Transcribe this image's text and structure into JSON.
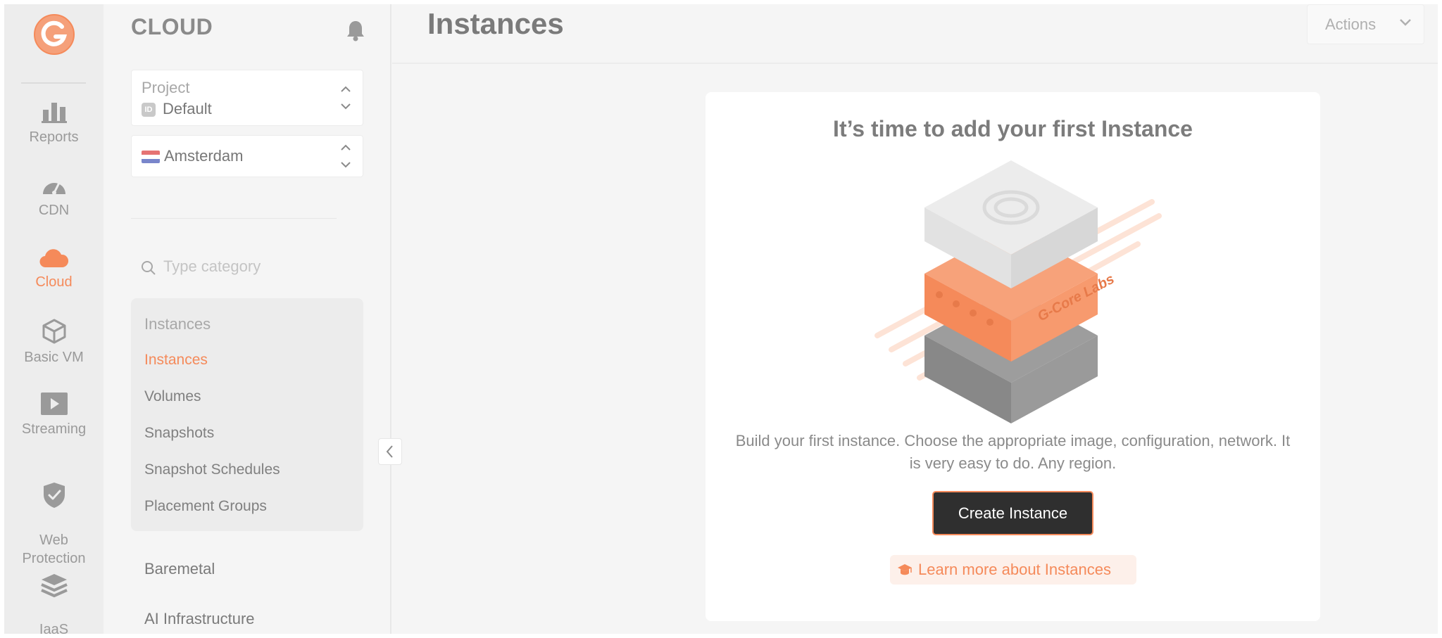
{
  "rail": {
    "items": [
      {
        "label": "Reports",
        "icon": "bar-chart-icon"
      },
      {
        "label": "CDN",
        "icon": "speedometer-icon"
      },
      {
        "label": "Cloud",
        "icon": "cloud-icon",
        "active": true
      },
      {
        "label": "Basic VM",
        "icon": "cube-icon"
      },
      {
        "label": "Streaming",
        "icon": "play-icon"
      },
      {
        "label": "Web\nProtection",
        "icon": "shield-icon"
      },
      {
        "label": "IaaS\nProtection",
        "icon": "layers-icon"
      }
    ]
  },
  "sidebar": {
    "brand": "CLOUD",
    "project": {
      "label": "Project",
      "id_badge": "ID",
      "value": "Default"
    },
    "region": {
      "value": "Amsterdam"
    },
    "search": {
      "placeholder": "Type category"
    },
    "menu": {
      "heading": "Instances",
      "items": [
        "Instances",
        "Volumes",
        "Snapshots",
        "Snapshot Schedules",
        "Placement Groups"
      ],
      "active": "Instances"
    },
    "sections": [
      "Baremetal",
      "AI Infrastructure"
    ]
  },
  "header": {
    "title": "Instances",
    "actions_label": "Actions"
  },
  "empty_state": {
    "title": "It’s time to add your first Instance",
    "description": "Build your first instance. Choose the appropriate image, configuration, network. It is very easy to do. Any region.",
    "illustration_text": "G-Core Labs",
    "create_label": "Create Instance",
    "learn_label": "Learn more about Instances"
  },
  "colors": {
    "accent": "#f58a5a",
    "dark_button": "#2f2f2f",
    "muted_text": "#8a8a8a"
  }
}
